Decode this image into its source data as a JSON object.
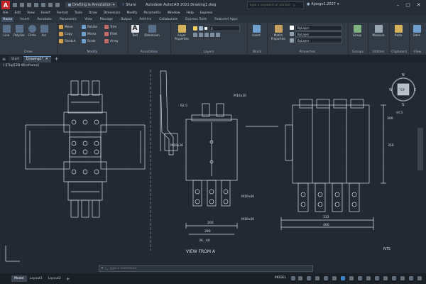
{
  "titlebar": {
    "logo": "A",
    "workspace": "Drafting & Annotation",
    "share": "Share",
    "title": "Autodesk AutoCAD 2021   Drawing1.dwg",
    "search_placeholder": "Type a keyword or phrase",
    "user": "Ajaxgo1.2027"
  },
  "menu": [
    "File",
    "Edit",
    "View",
    "Insert",
    "Format",
    "Tools",
    "Draw",
    "Dimension",
    "Modify",
    "Parametric",
    "Window",
    "Help",
    "Express"
  ],
  "ribbon_tabs": [
    {
      "label": "Home",
      "active": true
    },
    {
      "label": "Insert"
    },
    {
      "label": "Annotate"
    },
    {
      "label": "Parametric"
    },
    {
      "label": "View"
    },
    {
      "label": "Manage"
    },
    {
      "label": "Output"
    },
    {
      "label": "Add-ins"
    },
    {
      "label": "Collaborate"
    },
    {
      "label": "Express Tools"
    },
    {
      "label": "Featured Apps"
    }
  ],
  "ribbon": {
    "draw": {
      "title": "Draw",
      "line": "Line",
      "polyline": "Polyline",
      "circle": "Circle",
      "arc": "Arc"
    },
    "modify": {
      "title": "Modify",
      "move": "Move",
      "copy": "Copy",
      "stretch": "Stretch",
      "rotate": "Rotate",
      "mirror": "Mirror",
      "scale": "Scale",
      "trim": "Trim",
      "fillet": "Fillet",
      "array": "Array"
    },
    "annotation": {
      "title": "Annotation",
      "text": "Text",
      "dimension": "Dimension"
    },
    "layers": {
      "title": "Layers",
      "layer_properties": "Layer Properties"
    },
    "block": {
      "title": "Block",
      "insert": "Insert"
    },
    "properties": {
      "title": "Properties",
      "match": "Match Properties",
      "bylayer_color": "ByLayer",
      "bylayer_lineweight": "ByLayer",
      "bylayer_linetype": "ByLayer"
    },
    "groups": {
      "title": "Groups",
      "group": "Group"
    },
    "utilities": {
      "title": "Utilities",
      "measure": "Measure"
    },
    "clipboard": {
      "title": "Clipboard",
      "paste": "Paste"
    },
    "view": {
      "title": "View",
      "base": "Base"
    }
  },
  "file_tabs": [
    {
      "label": "Start"
    },
    {
      "label": "Drawing1*",
      "active": true
    }
  ],
  "viewport_label": "[-][Top][2D Wireframe]",
  "drawing_labels": {
    "view_caption": "VIEW FROM A",
    "nts": "NTS",
    "dim_62": "62.5",
    "dim_m10_a": "M10x30",
    "dim_m10_b": "M10x40",
    "dim_m10_c": "M10x40",
    "dim_m10_d": "M10x30",
    "dim_200": "200",
    "dim_280": "280",
    "dim_332": "332",
    "dim_460": "460",
    "dim_350": "350",
    "dim_300": "300",
    "dim_36": "36...40"
  },
  "viewcube": {
    "n": "N",
    "s": "S",
    "e": "E",
    "w": "W",
    "face": "TOP",
    "wcs": "WCS"
  },
  "command": {
    "placeholder": "Type a command"
  },
  "layout_tabs": [
    {
      "label": "Model",
      "active": true
    },
    {
      "label": "Layout1"
    },
    {
      "label": "Layout2"
    }
  ],
  "status": {
    "model": "MODEL"
  },
  "colors": {
    "accent": "#c7272d",
    "linework": "#d9dde2",
    "ribbon": "#323b46",
    "background": "#222933"
  }
}
